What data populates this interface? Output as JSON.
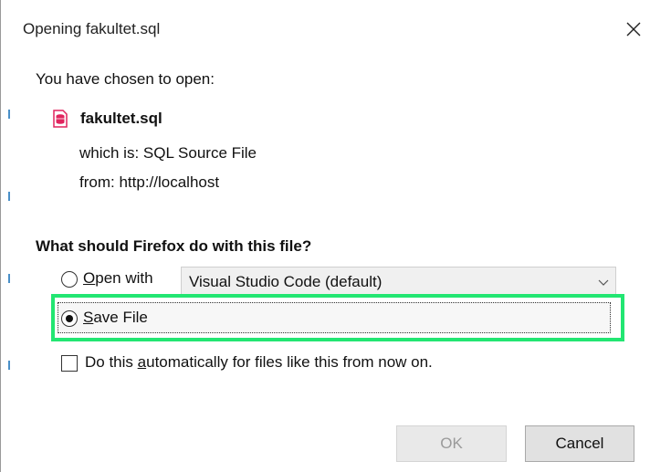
{
  "window": {
    "title": "Opening fakultet.sql",
    "close_icon": "close-icon"
  },
  "intro": {
    "text": "You have chosen to open:"
  },
  "file": {
    "icon": "sql-file-icon",
    "name": "fakultet.sql",
    "type_label": "which is:",
    "type_value": "SQL Source File",
    "from_label": "from:",
    "from_value": "http://localhost"
  },
  "question": "What should Firefox do with this file?",
  "options": {
    "open_with": {
      "label_prefix": "",
      "label_mnemonic": "O",
      "label_rest": "pen with",
      "selected": false,
      "app": "Visual Studio Code (default)"
    },
    "save_file": {
      "label_mnemonic": "S",
      "label_rest": "ave File",
      "selected": true
    },
    "auto": {
      "label_prefix": "Do this ",
      "label_mnemonic": "a",
      "label_rest": "utomatically for files like this from now on.",
      "checked": false
    }
  },
  "buttons": {
    "ok": "OK",
    "cancel": "Cancel"
  },
  "colors": {
    "highlight": "#22e672",
    "file_icon": "#e0245e"
  }
}
